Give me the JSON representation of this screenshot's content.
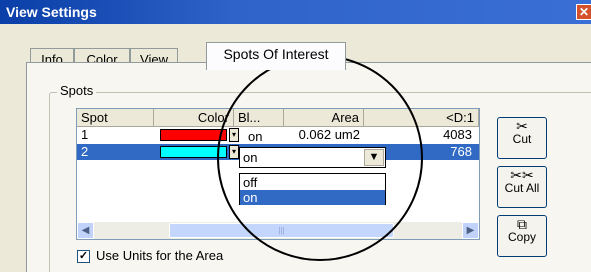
{
  "window": {
    "title": "View Settings",
    "close_glyph": "✕"
  },
  "tabs": [
    {
      "label": "Info",
      "active": false
    },
    {
      "label": "Color",
      "active": false
    },
    {
      "label": "View",
      "active": false
    },
    {
      "label": "Spots Of Interest",
      "active": true
    }
  ],
  "group": {
    "label": "Spots"
  },
  "table": {
    "columns": [
      "Spot",
      "Color",
      "Bl...",
      "Area",
      "<D:1"
    ],
    "rows": [
      {
        "spot": "1",
        "color": "#ff0000",
        "blink": "on",
        "area": "0.062 um2",
        "value": "4083",
        "selected": false
      },
      {
        "spot": "2",
        "color": "#00ffff",
        "blink": "on",
        "area": "",
        "value": "768",
        "selected": true
      }
    ]
  },
  "combo": {
    "value": "on",
    "options": [
      "off",
      "on"
    ],
    "selected_option": "on"
  },
  "buttons": {
    "cut": "Cut",
    "cut_all": "Cut All",
    "copy": "Copy"
  },
  "checkbox": {
    "label": "Use Units for the Area",
    "checked": true
  },
  "icons": {
    "cut": "scissors-icon",
    "cut_all": "scissors-multiple-icon",
    "copy": "copy-icon"
  },
  "colors": {
    "selection": "#316ac5",
    "titlebar": "#0a3ea8"
  }
}
